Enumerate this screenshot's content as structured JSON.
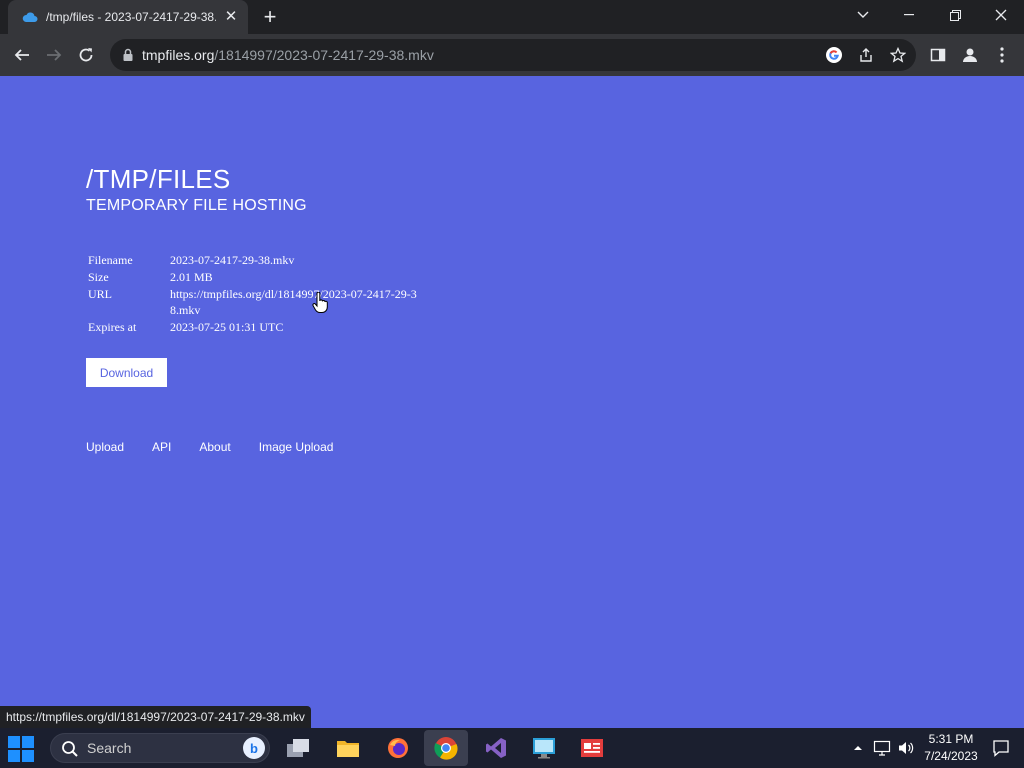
{
  "browser": {
    "tab_title": "/tmp/files - 2023-07-2417-29-38.mkv",
    "url_host": "tmpfiles.org",
    "url_path": "/1814997/2023-07-2417-29-38.mkv",
    "status_url": "https://tmpfiles.org/dl/1814997/2023-07-2417-29-38.mkv"
  },
  "page": {
    "title": "/TMP/FILES",
    "subtitle": "TEMPORARY FILE HOSTING",
    "info": [
      {
        "label": "Filename",
        "value": "2023-07-2417-29-38.mkv"
      },
      {
        "label": "Size",
        "value": "2.01 MB"
      },
      {
        "label": "URL",
        "value": "https://tmpfiles.org/dl/1814997/2023-07-2417-29-38.mkv"
      },
      {
        "label": "Expires at",
        "value": "2023-07-25 01:31 UTC"
      }
    ],
    "download_label": "Download",
    "nav": [
      "Upload",
      "API",
      "About",
      "Image Upload"
    ]
  },
  "taskbar": {
    "search_placeholder": "Search",
    "time": "5:31 PM",
    "date": "7/24/2023"
  },
  "colors": {
    "page_background": "#5864e0",
    "chrome_dark": "#202124",
    "chrome_toolbar": "#35363a"
  }
}
